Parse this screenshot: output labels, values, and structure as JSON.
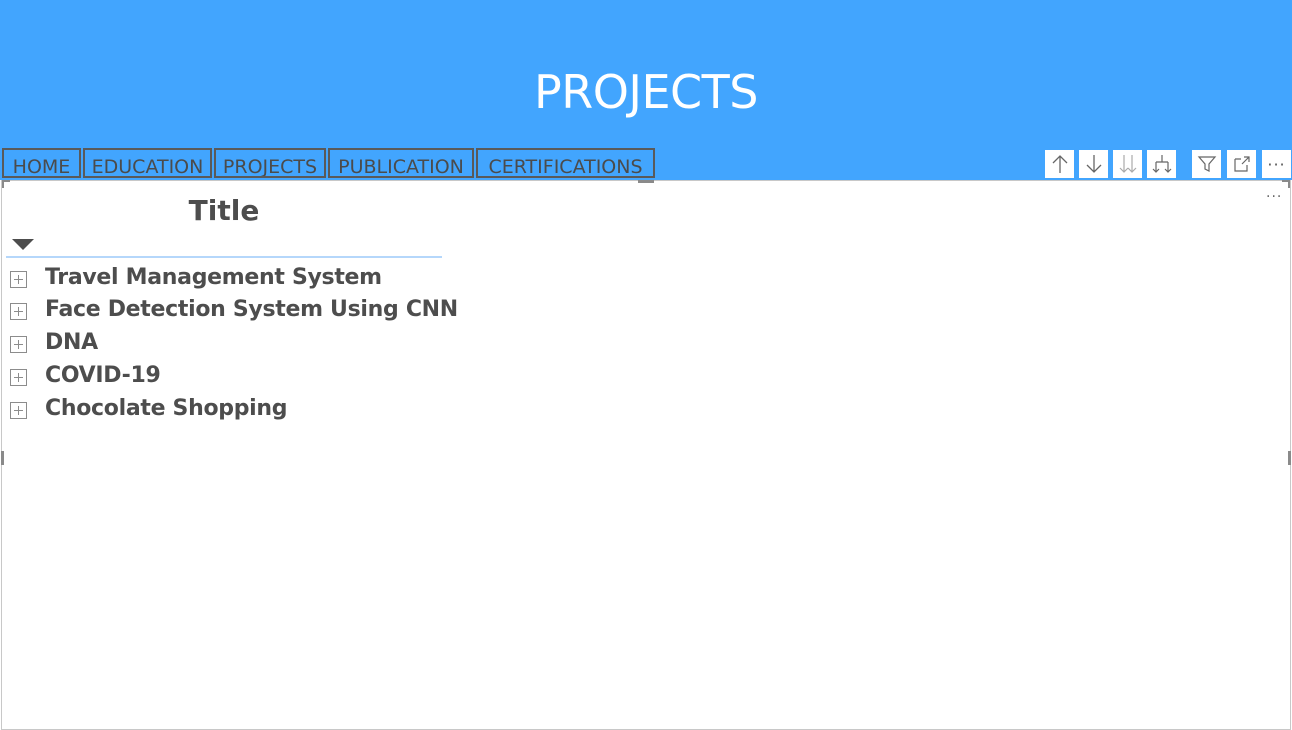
{
  "header": {
    "title": "PROJECTS",
    "background": "#42a5fe"
  },
  "nav": {
    "items": [
      {
        "label": "HOME"
      },
      {
        "label": "EDUCATION"
      },
      {
        "label": "PROJECTS"
      },
      {
        "label": "PUBLICATION"
      },
      {
        "label": "CERTIFICATIONS"
      }
    ]
  },
  "visual_toolbar": {
    "icons": [
      "arrow-up-icon",
      "arrow-down-icon",
      "double-arrow-down-icon",
      "expand-hierarchy-icon",
      "filter-icon",
      "focus-mode-icon",
      "more-options-icon"
    ],
    "more_label": "···"
  },
  "matrix": {
    "column_header": "Title",
    "rows": [
      {
        "label": "Travel Management System"
      },
      {
        "label": "Face Detection System Using CNN"
      },
      {
        "label": "DNA"
      },
      {
        "label": "COVID-19"
      },
      {
        "label": "Chocolate Shopping"
      }
    ],
    "more_label": "···"
  }
}
